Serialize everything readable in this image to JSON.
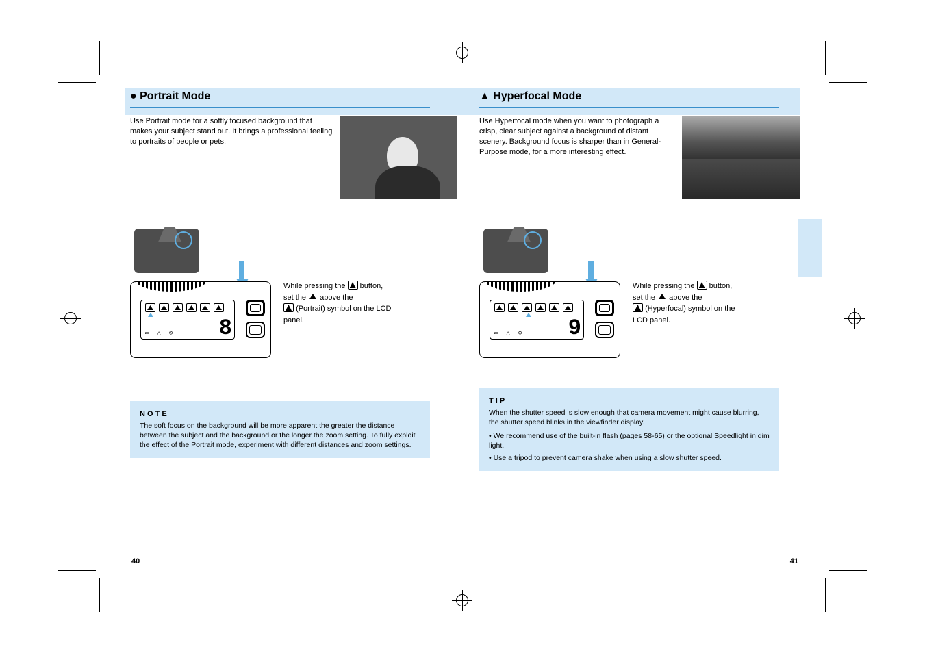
{
  "pageLeft": {
    "title_symbol": "●",
    "title_text": " Portrait Mode",
    "intro": "Use Portrait mode for a softly focused background that makes your subject stand out. It brings a professional feeling to portraits of people or pets.",
    "step_line1_pre": "While pressing the ",
    "step_line1_post": " button,",
    "step_line2_pre": "set the ",
    "step_line2_post": " above the ",
    "step_line3": "(Portrait) symbol on the LCD",
    "step_line4": "panel.",
    "note_title": "N O T E",
    "note_body": "The soft focus on the background will be more apparent the greater the distance between the subject and the background or the longer the zoom setting. To fully exploit the effect of the Portrait mode, experiment with different distances and zoom settings.",
    "lcd_number": "8",
    "page_number": "40"
  },
  "pageRight": {
    "title_symbol": "▲",
    "title_text": " Hyperfocal Mode",
    "intro": "Use Hyperfocal mode when you want to photograph a crisp, clear subject against a background of distant scenery. Background focus is sharper than in General-Purpose mode, for a more interesting effect.",
    "step_line1_pre": "While pressing the ",
    "step_line1_post": " button,",
    "step_line2_pre": "set the ",
    "step_line2_post": " above the ",
    "step_line3": "(Hyperfocal) symbol on the",
    "step_line4": "LCD panel.",
    "tip_title": "T I P",
    "tip_body1": "When the shutter speed is slow enough that camera movement might cause blurring, the shutter speed blinks in the viewfinder display.",
    "tip_body2": "• We recommend use of the built-in flash (pages 58-65) or the optional Speedlight in dim light.",
    "tip_body3": "• Use a tripod to prevent camera shake when using a slow shutter speed.",
    "lcd_number": "9",
    "page_number": "41"
  },
  "icons": {
    "subject_button": "subject-program-button-icon",
    "portrait": "portrait-mode-icon",
    "hyperfocal": "hyperfocal-mode-icon",
    "pointer": "selection-pointer"
  }
}
